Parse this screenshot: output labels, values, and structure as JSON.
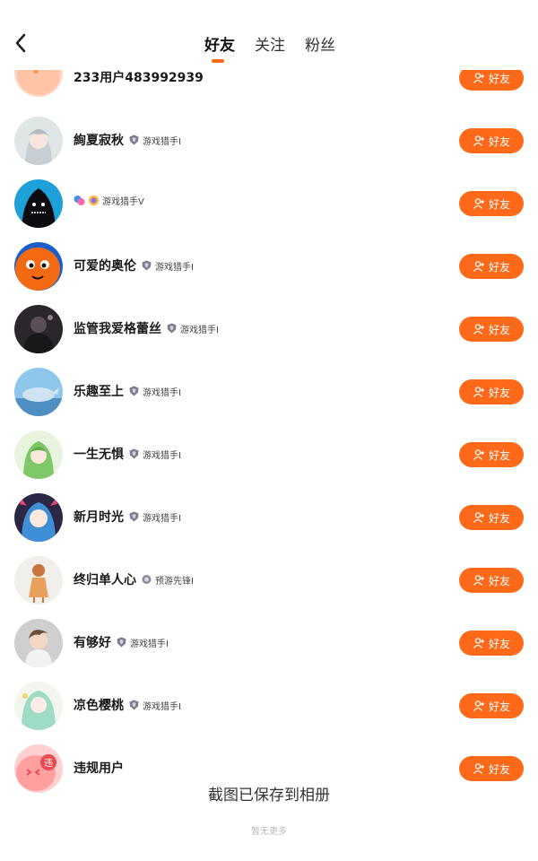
{
  "header": {
    "tabs": [
      {
        "label": "好友",
        "active": true
      },
      {
        "label": "关注",
        "active": false
      },
      {
        "label": "粉丝",
        "active": false
      }
    ]
  },
  "friends": [
    {
      "name": "233用户483992939",
      "badge": "",
      "avatar": "pink-blob-avatar"
    },
    {
      "name": "絢夏寂秋",
      "badge": "游戏猎手I",
      "avatar": "anime-girl-avatar"
    },
    {
      "name": "",
      "badge": "游戏猎手V",
      "avatar": "dark-monster-avatar"
    },
    {
      "name": "可爱的奥伦",
      "badge": "游戏猎手I",
      "avatar": "orange-character-avatar"
    },
    {
      "name": "监管我爱格蕾丝",
      "badge": "游戏猎手I",
      "avatar": "dark-figure-avatar"
    },
    {
      "name": "乐趣至上",
      "badge": "游戏猎手I",
      "avatar": "blue-whale-avatar"
    },
    {
      "name": "一生无惧",
      "badge": "游戏猎手I",
      "avatar": "green-hair-avatar"
    },
    {
      "name": "新月时光",
      "badge": "游戏猎手I",
      "avatar": "blue-hair-avatar"
    },
    {
      "name": "终归单人心",
      "badge": "预游先锋I",
      "avatar": "anime-figure-avatar"
    },
    {
      "name": "有够好",
      "badge": "游戏猎手I",
      "avatar": "brown-hair-avatar"
    },
    {
      "name": "凉色樱桃",
      "badge": "游戏猎手I",
      "avatar": "mint-hair-avatar"
    },
    {
      "name": "违规用户",
      "badge": "",
      "avatar": "violation-avatar",
      "avatar_text": "违"
    }
  ],
  "button_label": "好友",
  "toast": "截图已保存到相册",
  "footer_note": "暂无更多",
  "colors": {
    "accent": "#fe6a1a"
  }
}
